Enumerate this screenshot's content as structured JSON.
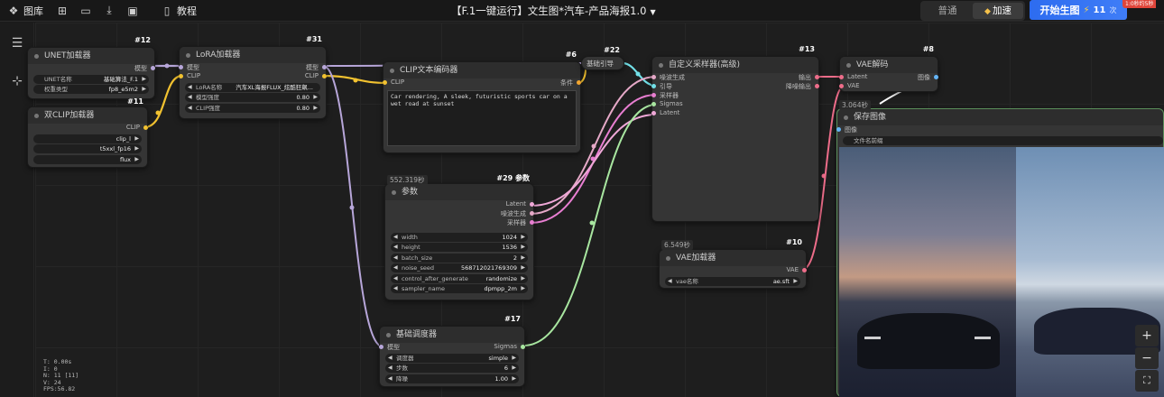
{
  "topbar": {
    "gallery": "图库",
    "tutorial": "教程",
    "title": "【F.1一键运行】文生图*汽车-产品海报1.0",
    "mode_normal": "普通",
    "mode_fast": "加速",
    "start_label": "开始生图",
    "start_count": "11",
    "start_unit": "次",
    "limit_badge": "1:0秒约5秒"
  },
  "colors": {
    "accent": "#3f7df7",
    "wire_purple": "#b7a6d9",
    "wire_yellow": "#f2c230",
    "wire_pink": "#ee6d8a",
    "wire_green": "#a8e6a0",
    "wire_white": "#ffffff"
  },
  "nodes": {
    "ckpt": {
      "id": "#12",
      "title": "UNET加载器",
      "out": "模型",
      "w1_label": "UNET名称",
      "w1_value": "基础算法_F.1",
      "w2_label": "权重类型",
      "w2_value": "fp8_e5m2"
    },
    "clipload": {
      "id": "#11",
      "title": "双CLIP加载器",
      "out": "CLIP",
      "w1_value": "clip_l",
      "w2_value": "t5xxl_fp16",
      "w3_value": "flux"
    },
    "lora": {
      "id": "#31",
      "title": "LoRA加载器",
      "in1": "模型",
      "in2": "CLIP",
      "out1": "模型",
      "out2": "CLIP",
      "w1_label": "LoRA名称",
      "w1_value": "汽车XL海报FLUX_炫酷狂飙...",
      "w2_label": "模型强度",
      "w2_value": "0.80",
      "w3_label": "CLIP强度",
      "w3_value": "0.80"
    },
    "clip": {
      "id": "#6",
      "title": "CLIP文本编码器",
      "in": "CLIP",
      "out": "条件",
      "text": "Car rendering, A sleek, futuristic sports car on a wet road at sunset"
    },
    "guider": {
      "id": "#22",
      "title": "基础引导"
    },
    "sampler": {
      "id": "#13",
      "title": "自定义采样器(高级)",
      "in1": "噪波生成",
      "in2": "引导",
      "in3": "采样器",
      "in4": "Sigmas",
      "in5": "Latent",
      "out1": "输出",
      "out2": "降噪输出"
    },
    "vaedec": {
      "id": "#8",
      "title": "VAE解码",
      "in1": "Latent",
      "in2": "VAE",
      "out": "图像"
    },
    "save": {
      "time": "3.064秒",
      "title": "保存图像",
      "in": "图像",
      "w1_label": "文件名前缀"
    },
    "params": {
      "id": "#29 参数",
      "time": "552.319秒",
      "title": "参数",
      "out1": "Latent",
      "out2": "噪波生成",
      "out3": "采样器",
      "rows": [
        {
          "label": "width",
          "value": "1024"
        },
        {
          "label": "height",
          "value": "1536"
        },
        {
          "label": "batch_size",
          "value": "2"
        },
        {
          "label": "noise_seed",
          "value": "568712021769309"
        },
        {
          "label": "control_after_generate",
          "value": "randomize"
        },
        {
          "label": "sampler_name",
          "value": "dpmpp_2m"
        }
      ]
    },
    "vaeload": {
      "id": "#10",
      "time": "6.549秒",
      "title": "VAE加载器",
      "out": "VAE",
      "w1_label": "vae名称",
      "w1_value": "ae.sft"
    },
    "sched": {
      "id": "#17",
      "title": "基础调度器",
      "in": "模型",
      "out": "Sigmas",
      "rows": [
        {
          "label": "调度器",
          "value": "simple"
        },
        {
          "label": "步数",
          "value": "6"
        },
        {
          "label": "降噪",
          "value": "1.00"
        }
      ]
    }
  },
  "stats": {
    "l1": "T: 0.00s",
    "l2": "I: 0",
    "l3": "N: 11 [11]",
    "l4": "V: 24",
    "l5": "FPS:56.82"
  }
}
